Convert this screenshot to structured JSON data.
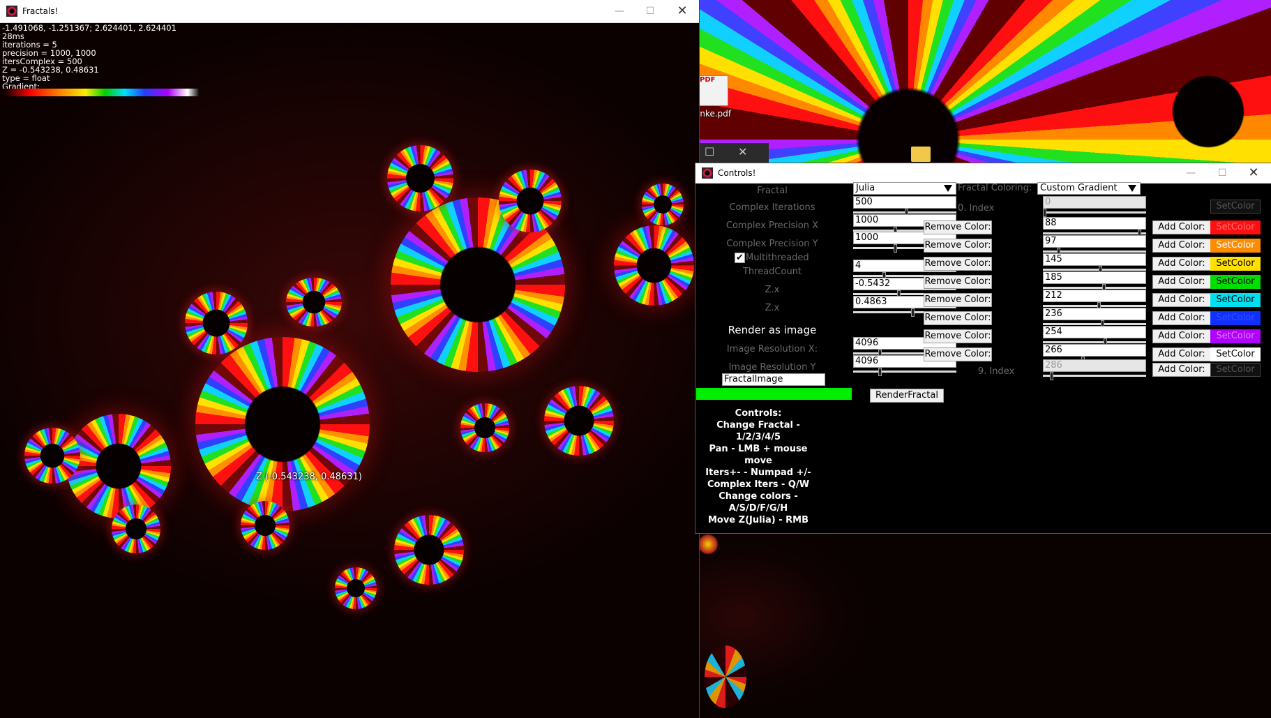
{
  "desktop": {
    "pdf_icon_text": "PDF",
    "pdf_label": "onke.pdf",
    "ghost_max": "☐",
    "ghost_close": "✕"
  },
  "fractals_window": {
    "title": "Fractals!",
    "minimize": "—",
    "maximize": "☐",
    "close": "✕",
    "overlay": [
      "-1.491068, -1.251367; 2.624401, 2.624401",
      "28ms",
      "iterations = 5",
      "precision = 1000, 1000",
      "itersComplex = 500",
      "Z = -0.543238, 0.48631",
      "type = float",
      "Gradient:"
    ],
    "z_label": "Z (-0.543238, 0.48631)"
  },
  "controls_window": {
    "title": "Controls!",
    "minimize": "—",
    "maximize": "☐",
    "close": "✕",
    "fractal_label": "Fractal",
    "fractal_value": "Julia",
    "coloring_label": "Fractal Coloring:",
    "coloring_value": "Custom Gradient",
    "complex_iterations_label": "Complex Iterations",
    "complex_iterations_value": "500",
    "precision_x_label": "Complex Precision X",
    "precision_x_value": "1000",
    "precision_y_label": "Complex Precision Y",
    "precision_y_value": "1000",
    "multithreaded_label": "Multithreaded",
    "multithreaded_check": "✔",
    "threadcount_label": "ThreadCount",
    "threadcount_value": "4",
    "zx_label": "Z.x",
    "zx_value": "-0.5432",
    "zy_label": "Z.x",
    "zy_value": "0.4863",
    "render_as_image": "Render as image",
    "res_x_label": "Image Resolution X:",
    "res_x_value": "4096",
    "res_y_label": "Image Resolution Y",
    "res_y_value": "4096",
    "image_name": "FractalImage",
    "render_button": "RenderFractal",
    "index0_label": "0. Index",
    "index0_value": "0",
    "index9_label": "9. Index",
    "index9_value": "286",
    "remove_color_label": "Remove Color:",
    "add_color_label": "Add Color:",
    "set_color_label": "SetColor",
    "gradient_rows": [
      {
        "value": "88",
        "color": "#ff1010",
        "text_color": "#ff7070"
      },
      {
        "value": "97",
        "color": "#ff8c00",
        "text_color": "#ffffff"
      },
      {
        "value": "145",
        "color": "#ffe000",
        "text_color": "#000000"
      },
      {
        "value": "185",
        "color": "#00dd00",
        "text_color": "#000000"
      },
      {
        "value": "212",
        "color": "#00e0f0",
        "text_color": "#000000"
      },
      {
        "value": "236",
        "color": "#1030ff",
        "text_color": "#3050ff"
      },
      {
        "value": "254",
        "color": "#b000ff",
        "text_color": "#e080ff"
      },
      {
        "value": "266",
        "color": "#ffffff",
        "text_color": "#000000"
      }
    ],
    "help_lines": [
      "Controls:",
      "Change Fractal - 1/2/3/4/5",
      "Pan - LMB + mouse move",
      "Iters+- - Numpad +/-",
      "Complex Iters - Q/W",
      "Change colors - A/S/D/F/G/H",
      "Move Z(Julia) - RMB"
    ]
  }
}
